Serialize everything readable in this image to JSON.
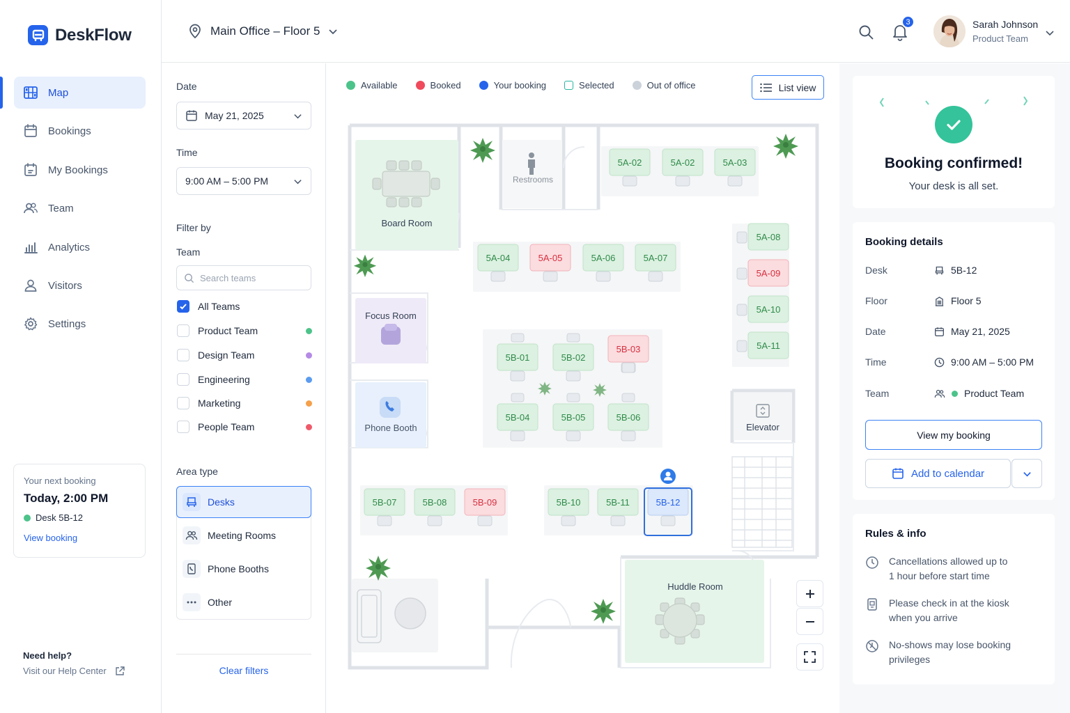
{
  "app": {
    "name": "DeskFlow"
  },
  "sidebar": {
    "items": [
      {
        "label": "Map",
        "icon": "map-icon"
      },
      {
        "label": "Bookings",
        "icon": "calendar-icon"
      },
      {
        "label": "My Bookings",
        "icon": "calendar-check-icon"
      },
      {
        "label": "Team",
        "icon": "users-icon"
      },
      {
        "label": "Analytics",
        "icon": "bar-chart-icon"
      },
      {
        "label": "Visitors",
        "icon": "user-icon"
      },
      {
        "label": "Settings",
        "icon": "gear-icon"
      }
    ],
    "next_booking": {
      "label": "Your next booking",
      "time": "Today, 2:00 PM",
      "desk": "Desk 5B-12",
      "link": "View booking"
    },
    "help": {
      "title": "Need help?",
      "link": "Visit our Help Center"
    }
  },
  "header": {
    "location": "Main Office – Floor 5",
    "notifications_count": "3",
    "user": {
      "name": "Sarah Johnson",
      "team": "Product Team"
    }
  },
  "filters": {
    "date_label": "Date",
    "date_value": "May 21, 2025",
    "time_label": "Time",
    "time_value": "9:00 AM – 5:00 PM",
    "filter_by": "Filter by",
    "team_label": "Team",
    "search_placeholder": "Search teams",
    "teams": [
      {
        "label": "All Teams",
        "checked": true,
        "color": ""
      },
      {
        "label": "Product Team",
        "checked": false,
        "color": "#4cc38a"
      },
      {
        "label": "Design Team",
        "checked": false,
        "color": "#b48ae6"
      },
      {
        "label": "Engineering",
        "checked": false,
        "color": "#5b9cf0"
      },
      {
        "label": "Marketing",
        "checked": false,
        "color": "#f5a04a"
      },
      {
        "label": "People Team",
        "checked": false,
        "color": "#ef5a6a"
      }
    ],
    "area_label": "Area type",
    "areas": [
      {
        "label": "Desks",
        "active": true
      },
      {
        "label": "Meeting Rooms",
        "active": false
      },
      {
        "label": "Phone Booths",
        "active": false
      },
      {
        "label": "Other",
        "active": false
      }
    ],
    "clear": "Clear filters"
  },
  "map": {
    "legend": [
      {
        "label": "Available",
        "color": "#4cc38a"
      },
      {
        "label": "Booked",
        "color": "#ef4b5c"
      },
      {
        "label": "Your booking",
        "color": "#2563eb"
      },
      {
        "label": "Selected",
        "color": "#26b5a0"
      },
      {
        "label": "Out of office",
        "color": "#cbd2da"
      }
    ],
    "list_view": "List view",
    "rooms": {
      "board": "Board Room",
      "restrooms": "Restrooms",
      "focus": "Focus Room",
      "phone": "Phone Booth",
      "elevator": "Elevator",
      "huddle": "Huddle Room"
    },
    "desks": [
      {
        "id": "5A-02",
        "status": "available"
      },
      {
        "id": "5A-02",
        "status": "available"
      },
      {
        "id": "5A-03",
        "status": "available"
      },
      {
        "id": "5A-04",
        "status": "available"
      },
      {
        "id": "5A-05",
        "status": "booked"
      },
      {
        "id": "5A-06",
        "status": "available"
      },
      {
        "id": "5A-07",
        "status": "available"
      },
      {
        "id": "5A-08",
        "status": "available"
      },
      {
        "id": "5A-09",
        "status": "booked"
      },
      {
        "id": "5A-10",
        "status": "available"
      },
      {
        "id": "5A-11",
        "status": "available"
      },
      {
        "id": "5B-01",
        "status": "available"
      },
      {
        "id": "5B-02",
        "status": "available"
      },
      {
        "id": "5B-03",
        "status": "booked"
      },
      {
        "id": "5B-04",
        "status": "available"
      },
      {
        "id": "5B-05",
        "status": "available"
      },
      {
        "id": "5B-06",
        "status": "available"
      },
      {
        "id": "5B-07",
        "status": "available"
      },
      {
        "id": "5B-08",
        "status": "available"
      },
      {
        "id": "5B-09",
        "status": "booked"
      },
      {
        "id": "5B-10",
        "status": "available"
      },
      {
        "id": "5B-11",
        "status": "available"
      },
      {
        "id": "5B-12",
        "status": "mine"
      }
    ]
  },
  "confirmation": {
    "title": "Booking confirmed!",
    "subtitle": "Your desk is all set."
  },
  "details": {
    "title": "Booking details",
    "rows": [
      {
        "key": "Desk",
        "value": "5B-12"
      },
      {
        "key": "Floor",
        "value": "Floor 5"
      },
      {
        "key": "Date",
        "value": "May 21, 2025"
      },
      {
        "key": "Time",
        "value": "9:00 AM – 5:00 PM"
      },
      {
        "key": "Team",
        "value": "Product Team"
      }
    ],
    "view_button": "View my booking",
    "calendar_button": "Add to calendar"
  },
  "rules": {
    "title": "Rules & info",
    "items": [
      {
        "line1": "Cancellations allowed up to",
        "line2": "1 hour before start time"
      },
      {
        "line1": "Please check in at the kiosk",
        "line2": "when you arrive"
      },
      {
        "line1": "No-shows may lose booking",
        "line2": "privileges"
      }
    ]
  }
}
